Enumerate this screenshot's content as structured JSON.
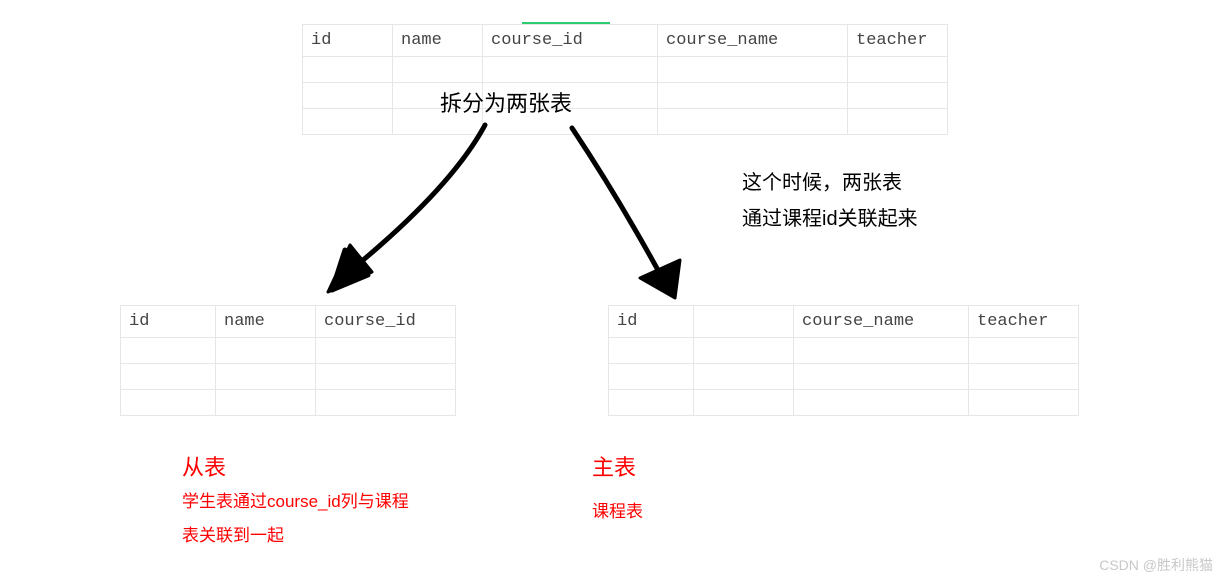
{
  "top_table": {
    "headers": [
      "id",
      "name",
      "course_id",
      "course_name",
      "teacher"
    ],
    "empty_rows": 3
  },
  "split_caption": "拆分为两张表",
  "relation_caption_line1": "这个时候，两张表",
  "relation_caption_line2": "通过课程id关联起来",
  "left_table": {
    "headers": [
      "id",
      "name",
      "course_id"
    ],
    "empty_rows": 3
  },
  "right_table": {
    "headers": [
      "id",
      "",
      "course_name",
      "teacher"
    ],
    "empty_rows": 3
  },
  "secondary_title": "从表",
  "secondary_desc_line1": "学生表通过course_id列与课程",
  "secondary_desc_line2": "表关联到一起",
  "primary_title": "主表",
  "primary_desc": "课程表",
  "watermark": "CSDN @胜利熊猫"
}
